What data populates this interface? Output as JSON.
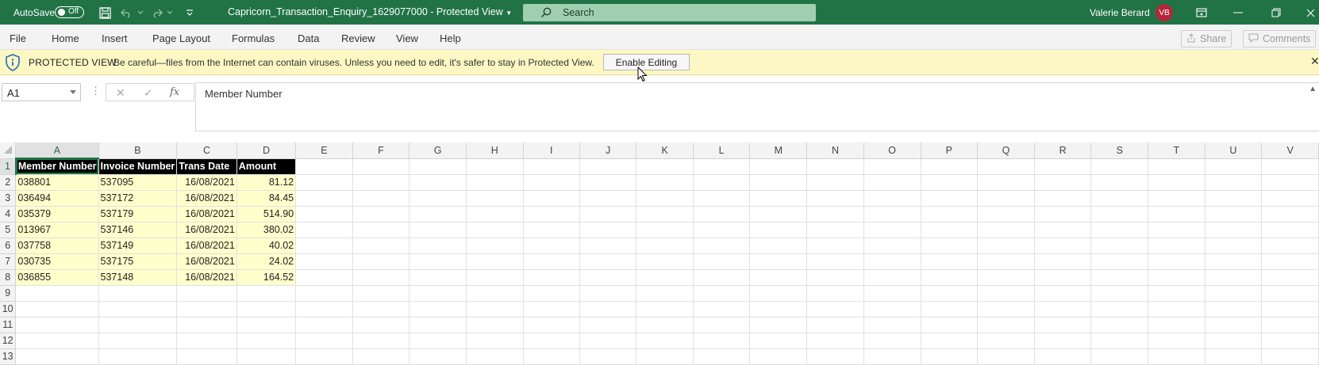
{
  "titlebar": {
    "autosave_label": "AutoSave",
    "autosave_state": "Off",
    "document_title": "Capricorn_Transaction_Enquiry_1629077000  -  Protected View",
    "search_placeholder": "Search",
    "user_name": "Valerie Berard",
    "user_initials": "VB",
    "accent_color": "#217346",
    "avatar_color": "#b3263a"
  },
  "menu": {
    "items": [
      "File",
      "Home",
      "Insert",
      "Page Layout",
      "Formulas",
      "Data",
      "Review",
      "View",
      "Help"
    ],
    "share_label": "Share",
    "comments_label": "Comments"
  },
  "protected_view": {
    "title": "PROTECTED VIEW",
    "message": "Be careful—files from the Internet can contain viruses. Unless you need to edit, it's safer to stay in Protected View.",
    "enable_button": "Enable Editing",
    "close_icon": "✕"
  },
  "formula_bar": {
    "name_box": "A1",
    "cancel_icon": "✕",
    "enter_icon": "✓",
    "fx_label": "fx",
    "content": "Member Number"
  },
  "sheet": {
    "column_headers": [
      "A",
      "B",
      "C",
      "D",
      "E",
      "F",
      "G",
      "H",
      "I",
      "J",
      "K",
      "L",
      "M",
      "N",
      "O",
      "P",
      "Q",
      "R",
      "S",
      "T",
      "U",
      "V"
    ],
    "row_headers": [
      "1",
      "2",
      "3",
      "4",
      "5",
      "6",
      "7",
      "8",
      "9",
      "10",
      "11",
      "12",
      "13"
    ],
    "header_row": [
      "Member Number",
      "Invoice Number",
      "Trans Date",
      "Amount"
    ],
    "rows": [
      [
        "038801",
        "537095",
        "16/08/2021",
        "81.12"
      ],
      [
        "036494",
        "537172",
        "16/08/2021",
        "84.45"
      ],
      [
        "035379",
        "537179",
        "16/08/2021",
        "514.90"
      ],
      [
        "013967",
        "537146",
        "16/08/2021",
        "380.02"
      ],
      [
        "037758",
        "537149",
        "16/08/2021",
        "40.02"
      ],
      [
        "030735",
        "537175",
        "16/08/2021",
        "24.02"
      ],
      [
        "036855",
        "537148",
        "16/08/2021",
        "164.52"
      ]
    ],
    "selected_cell": "A1"
  }
}
